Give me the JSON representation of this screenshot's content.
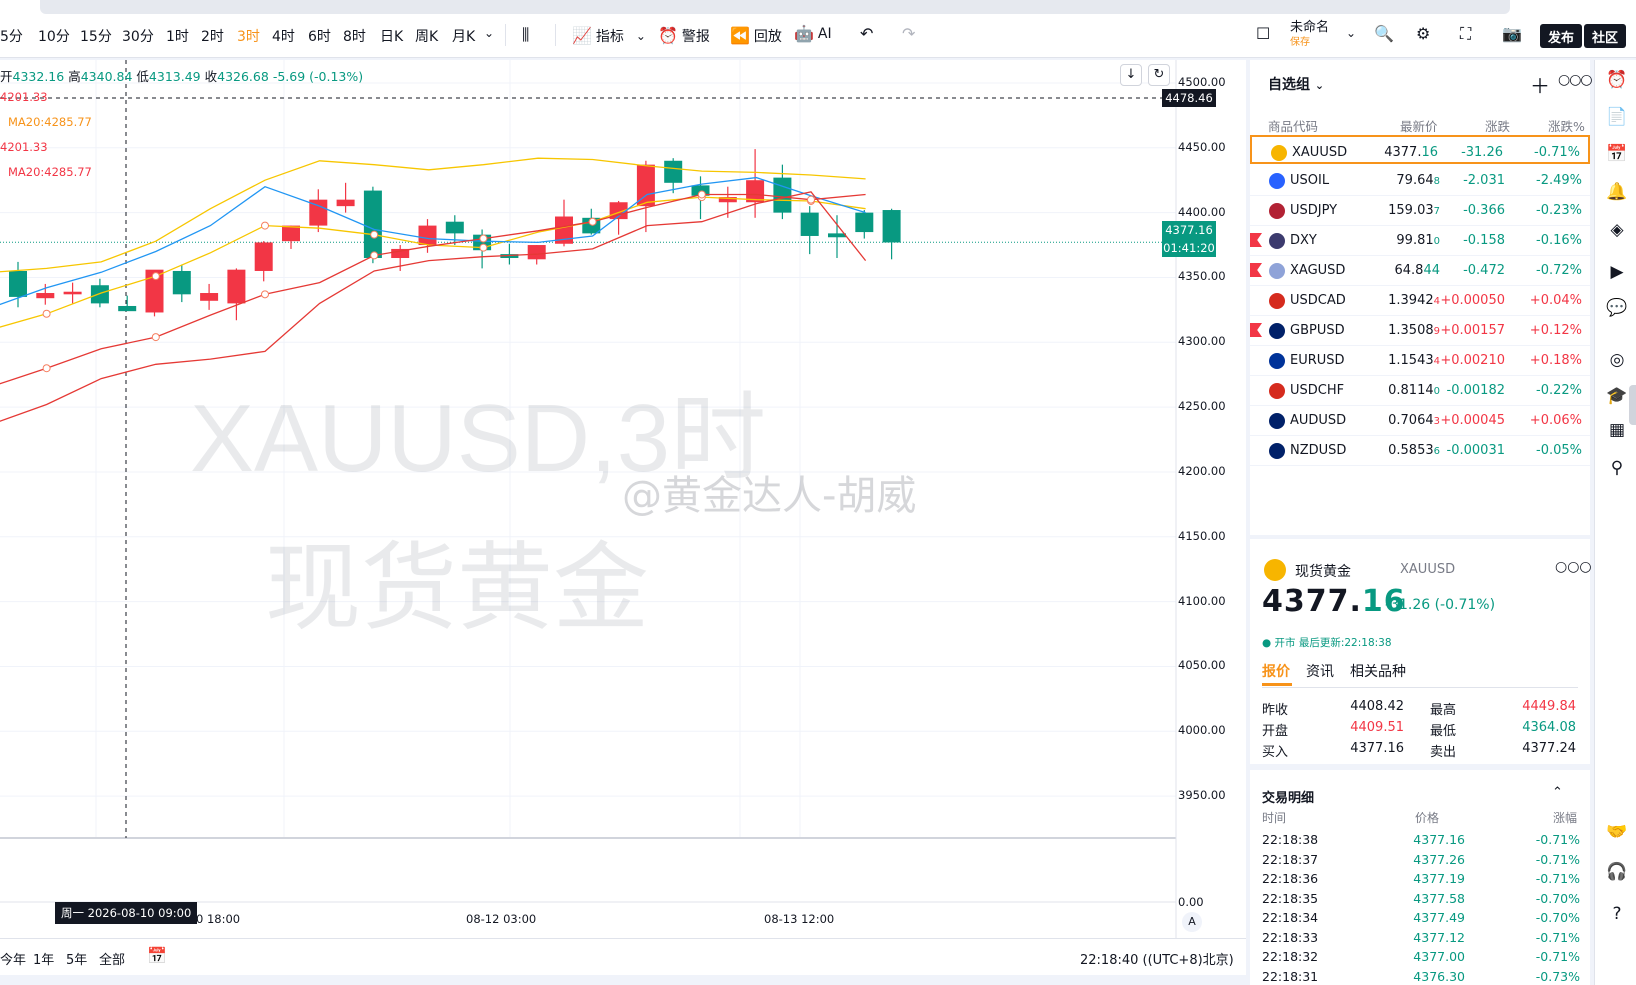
{
  "toolbar": {
    "timeframes": [
      {
        "label": "5分",
        "active": false
      },
      {
        "label": "10分",
        "active": false
      },
      {
        "label": "15分",
        "active": false
      },
      {
        "label": "30分",
        "active": false
      },
      {
        "label": "1时",
        "active": false
      },
      {
        "label": "2时",
        "active": false
      },
      {
        "label": "3时",
        "active": true
      },
      {
        "label": "4时",
        "active": false
      },
      {
        "label": "6时",
        "active": false
      },
      {
        "label": "8时",
        "active": false
      },
      {
        "label": "日K",
        "active": false
      },
      {
        "label": "周K",
        "active": false
      },
      {
        "label": "月K",
        "active": false
      }
    ],
    "indicators_label": "指标",
    "alert_label": "警报",
    "replay_label": "回放",
    "ai_label": "AI",
    "layout_name": "未命名",
    "layout_save": "保存",
    "publish_label": "发布",
    "community_label": "社区"
  },
  "chart": {
    "symbol": "XAUUSD",
    "ohlc": {
      "open_label": "开",
      "open": "4332.16",
      "high_label": "高",
      "high": "4340.84",
      "low_label": "低",
      "low": "4313.49",
      "close_label": "收",
      "close": "4326.68",
      "change": "-5.69",
      "change_pct": "(-0.13%)"
    },
    "ma_lines": [
      {
        "text": "4201.33",
        "color": "#f23645"
      },
      {
        "text": "MA20:4285.77",
        "color": "#f7931a"
      },
      {
        "text": "4201.33",
        "color": "#f23645"
      },
      {
        "text": "MA20:4285.77",
        "color": "#f23645"
      }
    ],
    "watermark_symbol": "XAUUSD,3时",
    "watermark_name": "现货黄金",
    "watermark_source": "@黄金达人-胡威",
    "y_ticks": [
      "4500.00",
      "4450.00",
      "4400.00",
      "4350.00",
      "4300.00",
      "4250.00",
      "4200.00",
      "4150.00",
      "4100.00",
      "4050.00",
      "4000.00",
      "3950.00"
    ],
    "volume_tick": "0.00",
    "crosshair_price": "4478.46",
    "last_price": "4377.16",
    "countdown": "01:41:20",
    "x_ticks": [
      "0 18:00",
      "08-12 03:00",
      "08-13 12:00"
    ],
    "crosshair_time": "周一 2026-08-10  09:00",
    "axis_mode": "A",
    "ranges": [
      "今年",
      "1年",
      "5年",
      "全部"
    ],
    "clock": "22:18:40 ((UTC+8)北京)"
  },
  "chart_data": {
    "type": "candlestick",
    "title": "XAUUSD,3时",
    "ylim": [
      3920,
      4510
    ],
    "candles": [
      {
        "o": 4355,
        "h": 4362,
        "l": 4327,
        "c": 4335
      },
      {
        "o": 4334,
        "h": 4345,
        "l": 4329,
        "c": 4338
      },
      {
        "o": 4337,
        "h": 4346,
        "l": 4330,
        "c": 4339
      },
      {
        "o": 4344,
        "h": 4349,
        "l": 4327,
        "c": 4330
      },
      {
        "o": 4328,
        "h": 4336,
        "l": 4325,
        "c": 4324
      },
      {
        "o": 4323,
        "h": 4355,
        "l": 4320,
        "c": 4356
      },
      {
        "o": 4355,
        "h": 4360,
        "l": 4331,
        "c": 4337
      },
      {
        "o": 4332,
        "h": 4345,
        "l": 4325,
        "c": 4338
      },
      {
        "o": 4330,
        "h": 4357,
        "l": 4317,
        "c": 4356
      },
      {
        "o": 4355,
        "h": 4378,
        "l": 4347,
        "c": 4377
      },
      {
        "o": 4378,
        "h": 4390,
        "l": 4372,
        "c": 4390
      },
      {
        "o": 4390,
        "h": 4418,
        "l": 4385,
        "c": 4410
      },
      {
        "o": 4405,
        "h": 4423,
        "l": 4400,
        "c": 4410
      },
      {
        "o": 4417,
        "h": 4420,
        "l": 4361,
        "c": 4365
      },
      {
        "o": 4365,
        "h": 4375,
        "l": 4355,
        "c": 4372
      },
      {
        "o": 4375,
        "h": 4395,
        "l": 4369,
        "c": 4390
      },
      {
        "o": 4393,
        "h": 4398,
        "l": 4375,
        "c": 4384
      },
      {
        "o": 4383,
        "h": 4387,
        "l": 4357,
        "c": 4371
      },
      {
        "o": 4368,
        "h": 4376,
        "l": 4360,
        "c": 4365
      },
      {
        "o": 4364,
        "h": 4375,
        "l": 4360,
        "c": 4375
      },
      {
        "o": 4376,
        "h": 4410,
        "l": 4374,
        "c": 4397
      },
      {
        "o": 4396,
        "h": 4403,
        "l": 4383,
        "c": 4384
      },
      {
        "o": 4395,
        "h": 4409,
        "l": 4383,
        "c": 4408
      },
      {
        "o": 4405,
        "h": 4440,
        "l": 4385,
        "c": 4437
      },
      {
        "o": 4440,
        "h": 4442,
        "l": 4415,
        "c": 4423
      },
      {
        "o": 4421,
        "h": 4428,
        "l": 4395,
        "c": 4413
      },
      {
        "o": 4408,
        "h": 4420,
        "l": 4396,
        "c": 4412
      },
      {
        "o": 4408,
        "h": 4449,
        "l": 4396,
        "c": 4425
      },
      {
        "o": 4427,
        "h": 4437,
        "l": 4395,
        "c": 4400
      },
      {
        "o": 4400,
        "h": 4405,
        "l": 4368,
        "c": 4382
      },
      {
        "o": 4384,
        "h": 4398,
        "l": 4365,
        "c": 4381
      },
      {
        "o": 4400,
        "h": 4402,
        "l": 4380,
        "c": 4385
      },
      {
        "o": 4402,
        "h": 4403,
        "l": 4364,
        "c": 4377
      }
    ],
    "bands": {
      "upper": [
        4354,
        4357,
        4362,
        4378,
        4403,
        4425,
        4440,
        4437,
        4433,
        4437,
        4442,
        4441,
        4436,
        4432,
        4431,
        4429,
        4426
      ],
      "middle": [
        4310,
        4322,
        4338,
        4351,
        4369,
        4390,
        4388,
        4383,
        4375,
        4373,
        4385,
        4393,
        4408,
        4412,
        4410,
        4409,
        4403
      ],
      "lower": [
        4237,
        4252,
        4272,
        4283,
        4287,
        4293,
        4330,
        4355,
        4363,
        4366,
        4368,
        4372,
        4390,
        4393,
        4407,
        4416,
        4363
      ]
    },
    "ma_slow": [
      4266,
      4280,
      4295,
      4304,
      4321,
      4337,
      4346,
      4367,
      4374,
      4380,
      4386,
      4393,
      4404,
      4414,
      4414,
      4410,
      4414
    ],
    "ma_fast": [
      4327,
      4342,
      4354,
      4370,
      4390,
      4420,
      4405,
      4387,
      4380,
      4378,
      4377,
      4382,
      4414,
      4422,
      4427,
      4413,
      4400
    ]
  },
  "watchlist": {
    "title": "自选组",
    "headers": [
      "商品代码",
      "最新价",
      "涨跌",
      "涨跌%"
    ],
    "rows": [
      {
        "symbol": "XAUUSD",
        "last_main": "4377.",
        "last_tail": "16",
        "change": "-31.26",
        "pct": "-0.71%",
        "dir": "dn",
        "icon_color": "#f7b500",
        "flagged": false,
        "selected": true
      },
      {
        "symbol": "USOIL",
        "last_main": "79.64",
        "last_tail": "8",
        "change": "-2.031",
        "pct": "-2.49%",
        "dir": "dn",
        "icon_color": "#2962ff",
        "flagged": false,
        "selected": false
      },
      {
        "symbol": "USDJPY",
        "last_main": "159.03",
        "last_tail": "7",
        "change": "-0.366",
        "pct": "-0.23%",
        "dir": "dn",
        "icon_color": "#b22234",
        "flagged": false,
        "selected": false
      },
      {
        "symbol": "DXY",
        "last_main": "99.81",
        "last_tail": "0",
        "change": "-0.158",
        "pct": "-0.16%",
        "dir": "dn",
        "icon_color": "#3c3b6e",
        "flagged": true,
        "selected": false
      },
      {
        "symbol": "XAGUSD",
        "last_main": "64.8",
        "last_tail": "44",
        "change": "-0.472",
        "pct": "-0.72%",
        "dir": "dn",
        "icon_color": "#8fa3d8",
        "flagged": true,
        "selected": false
      },
      {
        "symbol": "USDCAD",
        "last_main": "1.3942",
        "last_tail": "4",
        "change": "+0.00050",
        "pct": "+0.04%",
        "dir": "up",
        "icon_color": "#d52b1e",
        "flagged": false,
        "selected": false
      },
      {
        "symbol": "GBPUSD",
        "last_main": "1.3508",
        "last_tail": "9",
        "change": "+0.00157",
        "pct": "+0.12%",
        "dir": "up",
        "icon_color": "#012169",
        "flagged": true,
        "selected": false
      },
      {
        "symbol": "EURUSD",
        "last_main": "1.1543",
        "last_tail": "4",
        "change": "+0.00210",
        "pct": "+0.18%",
        "dir": "up",
        "icon_color": "#003399",
        "flagged": false,
        "selected": false
      },
      {
        "symbol": "USDCHF",
        "last_main": "0.8114",
        "last_tail": "0",
        "change": "-0.00182",
        "pct": "-0.22%",
        "dir": "dn",
        "icon_color": "#d52b1e",
        "flagged": false,
        "selected": false
      },
      {
        "symbol": "AUDUSD",
        "last_main": "0.7064",
        "last_tail": "3",
        "change": "+0.00045",
        "pct": "+0.06%",
        "dir": "up",
        "icon_color": "#012169",
        "flagged": false,
        "selected": false
      },
      {
        "symbol": "NZDUSD",
        "last_main": "0.5853",
        "last_tail": "6",
        "change": "-0.00031",
        "pct": "-0.05%",
        "dir": "dn",
        "icon_color": "#012169",
        "flagged": false,
        "selected": false
      }
    ]
  },
  "details": {
    "name": "现货黄金",
    "code": "XAUUSD",
    "price_main": "4377.",
    "price_tail": "16",
    "change": "-31.26 (-0.71%)",
    "status": "● 开市 最后更新:22:18:38",
    "tabs": [
      "报价",
      "资讯",
      "相关品种"
    ],
    "quote": [
      {
        "k1": "昨收",
        "v1": "4408.42",
        "c1": "#131722",
        "k2": "最高",
        "v2": "4449.84",
        "c2": "#f23645"
      },
      {
        "k1": "开盘",
        "v1": "4409.51",
        "c1": "#f23645",
        "k2": "最低",
        "v2": "4364.08",
        "c2": "#089981"
      },
      {
        "k1": "买入",
        "v1": "4377.16",
        "c1": "#131722",
        "k2": "卖出",
        "v2": "4377.24",
        "c2": "#131722"
      }
    ],
    "trades_title": "交易明细",
    "trades_headers": [
      "时间",
      "价格",
      "涨幅"
    ],
    "trades": [
      {
        "time": "22:18:38",
        "price": "4377.16",
        "change": "-0.71%"
      },
      {
        "time": "22:18:37",
        "price": "4377.26",
        "change": "-0.71%"
      },
      {
        "time": "22:18:36",
        "price": "4377.19",
        "change": "-0.71%"
      },
      {
        "time": "22:18:35",
        "price": "4377.58",
        "change": "-0.70%"
      },
      {
        "time": "22:18:34",
        "price": "4377.49",
        "change": "-0.70%"
      },
      {
        "time": "22:18:33",
        "price": "4377.12",
        "change": "-0.71%"
      },
      {
        "time": "22:18:32",
        "price": "4377.00",
        "change": "-0.71%"
      },
      {
        "time": "22:18:31",
        "price": "4376.30",
        "change": "-0.73%"
      }
    ]
  },
  "sidebar_icons": [
    "alert-clock-icon",
    "notes-icon",
    "calendar-icon",
    "bell-icon",
    "layers-icon",
    "live-icon",
    "chat-icon",
    "target-icon",
    "academy-icon",
    "grid-icon",
    "tree-icon",
    "handshake-icon",
    "headset-icon",
    "help-icon"
  ],
  "colors": {
    "up": "#f23645",
    "down": "#089981",
    "accent": "#f7931a",
    "band_outer": "#f7c600",
    "ma_fast": "#2196f3",
    "ma_slow": "#e53935"
  }
}
